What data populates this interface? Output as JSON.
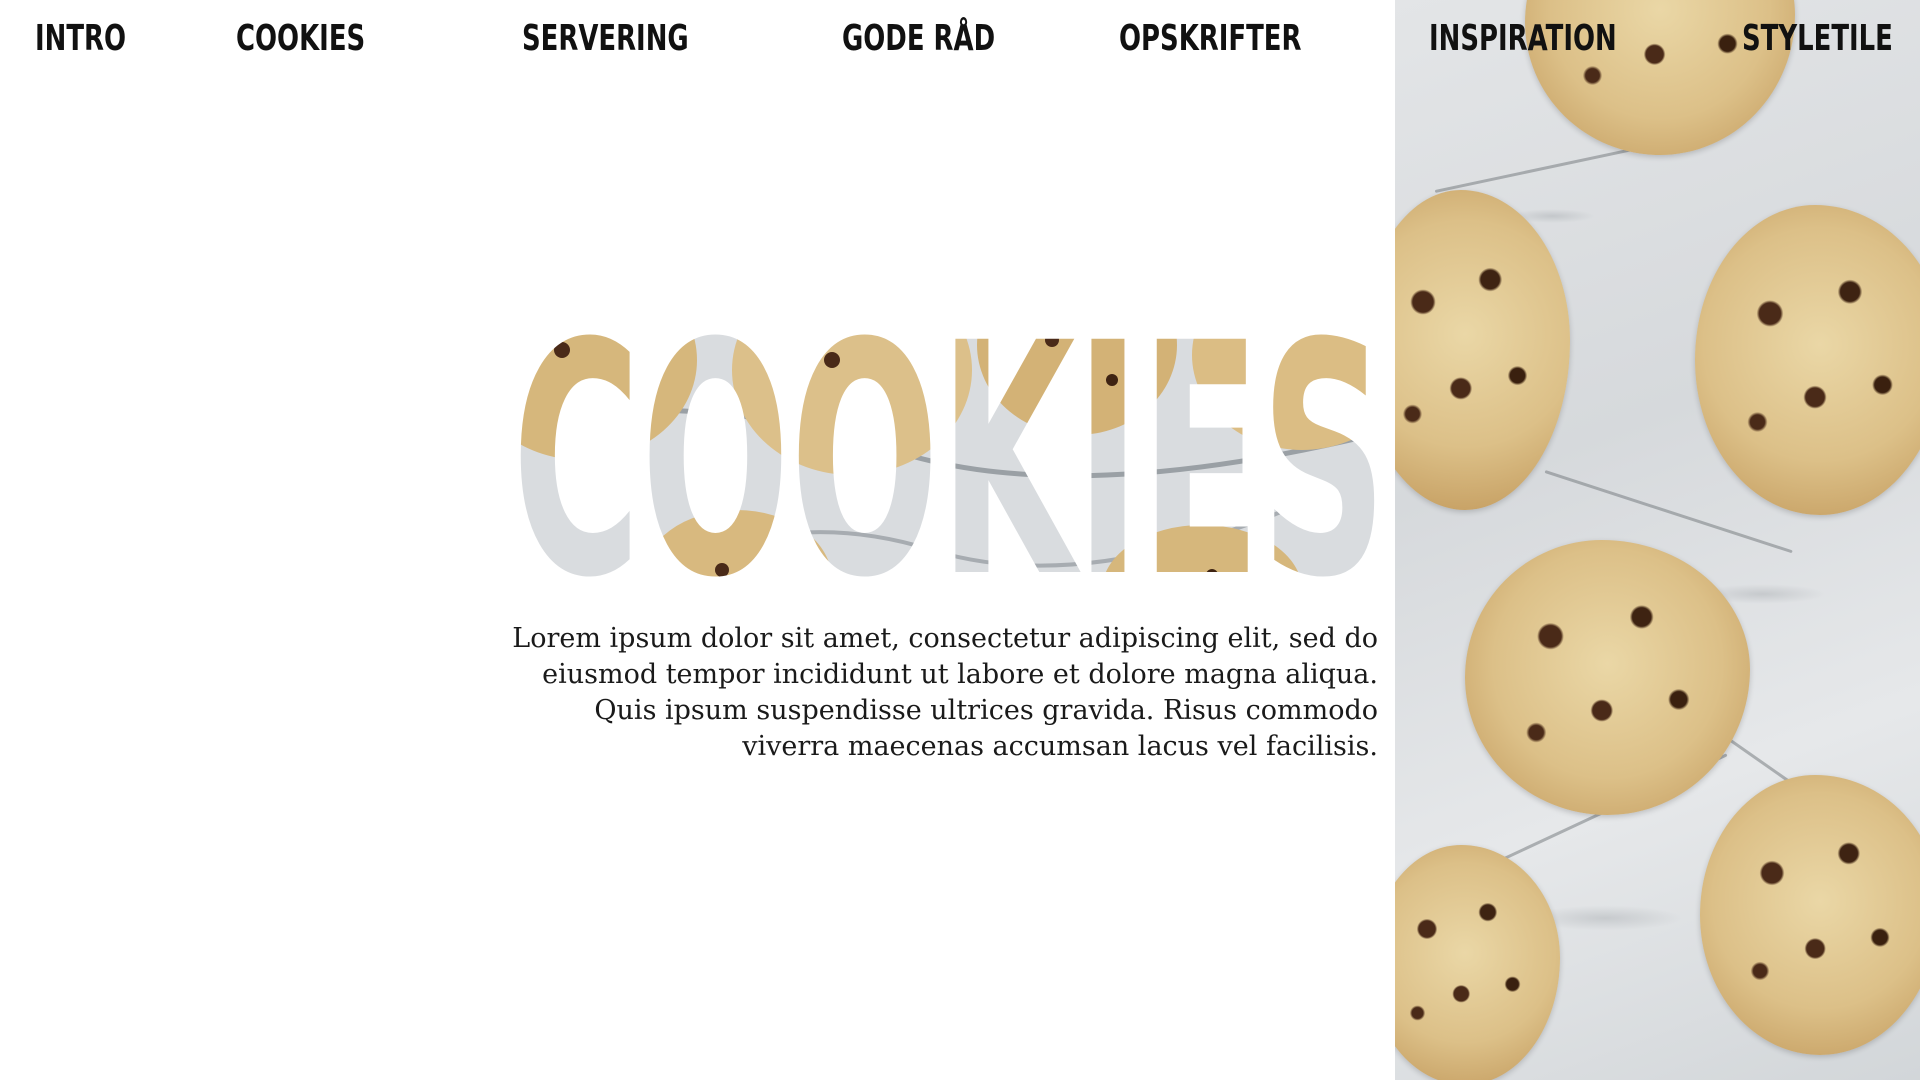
{
  "nav": {
    "items": [
      {
        "label": "INTRO"
      },
      {
        "label": "COOKIES"
      },
      {
        "label": "SERVERING"
      },
      {
        "label": "GODE RÅD"
      },
      {
        "label": "OPSKRIFTER"
      },
      {
        "label": "INSPIRATION"
      },
      {
        "label": "STYLETILE"
      }
    ]
  },
  "hero": {
    "title": "COOKIES",
    "paragraph": "Lorem ipsum dolor sit amet, consectetur adipiscing elit, sed do eiusmod tempor incididunt ut labore et dolore magna aliqua. Quis ipsum suspendisse ultrices gravida. Risus commodo viverra maecenas accumsan lacus vel facilisis."
  },
  "colors": {
    "text": "#111111",
    "background": "#ffffff",
    "marble": "#dfe2e5",
    "cookie": "#d9bb82",
    "chocolate": "#4a2a18"
  }
}
